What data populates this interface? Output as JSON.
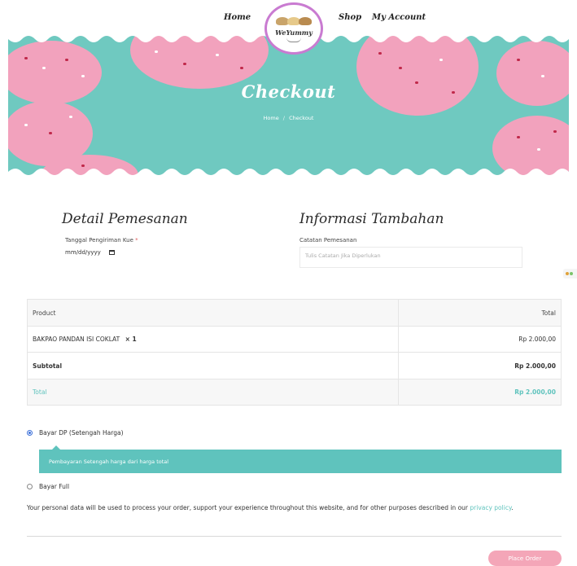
{
  "nav": {
    "home": "Home",
    "shop": "Shop",
    "account": "My Account",
    "brand": "WeYummy"
  },
  "hero": {
    "title": "Checkout",
    "crumb_home": "Home",
    "crumb_sep": "/",
    "crumb_current": "Checkout"
  },
  "order_details": {
    "heading": "Detail Pemesanan",
    "date_label": "Tanggal Pengiriman Kue",
    "required_mark": "*",
    "date_placeholder": "mm/dd/yyyy"
  },
  "additional_info": {
    "heading": "Informasi Tambahan",
    "notes_label": "Catatan Pemesanan",
    "notes_placeholder": "Tulis Catatan Jika Diperlukan"
  },
  "order_table": {
    "col_product": "Product",
    "col_total": "Total",
    "item_name": "BAKPAO PANDAN ISI COKLAT",
    "item_qty": "× 1",
    "item_total": "Rp 2.000,00",
    "subtotal_label": "Subtotal",
    "subtotal_value": "Rp 2.000,00",
    "total_label": "Total",
    "total_value": "Rp 2.000,00"
  },
  "payment": {
    "option_dp": "Bayar DP (Setengah Harga)",
    "option_dp_desc": "Pembayaran Setengah harga dari harga total",
    "option_full": "Bayar Full",
    "privacy_text": "Your personal data will be used to process your order, support your experience throughout this website, and for other purposes described in our",
    "privacy_link": "privacy policy",
    "place_order": "Place Order"
  },
  "colors": {
    "teal": "#5fc3bd",
    "pink": "#f4a6b8",
    "hero_bg": "#6fc9c0"
  }
}
